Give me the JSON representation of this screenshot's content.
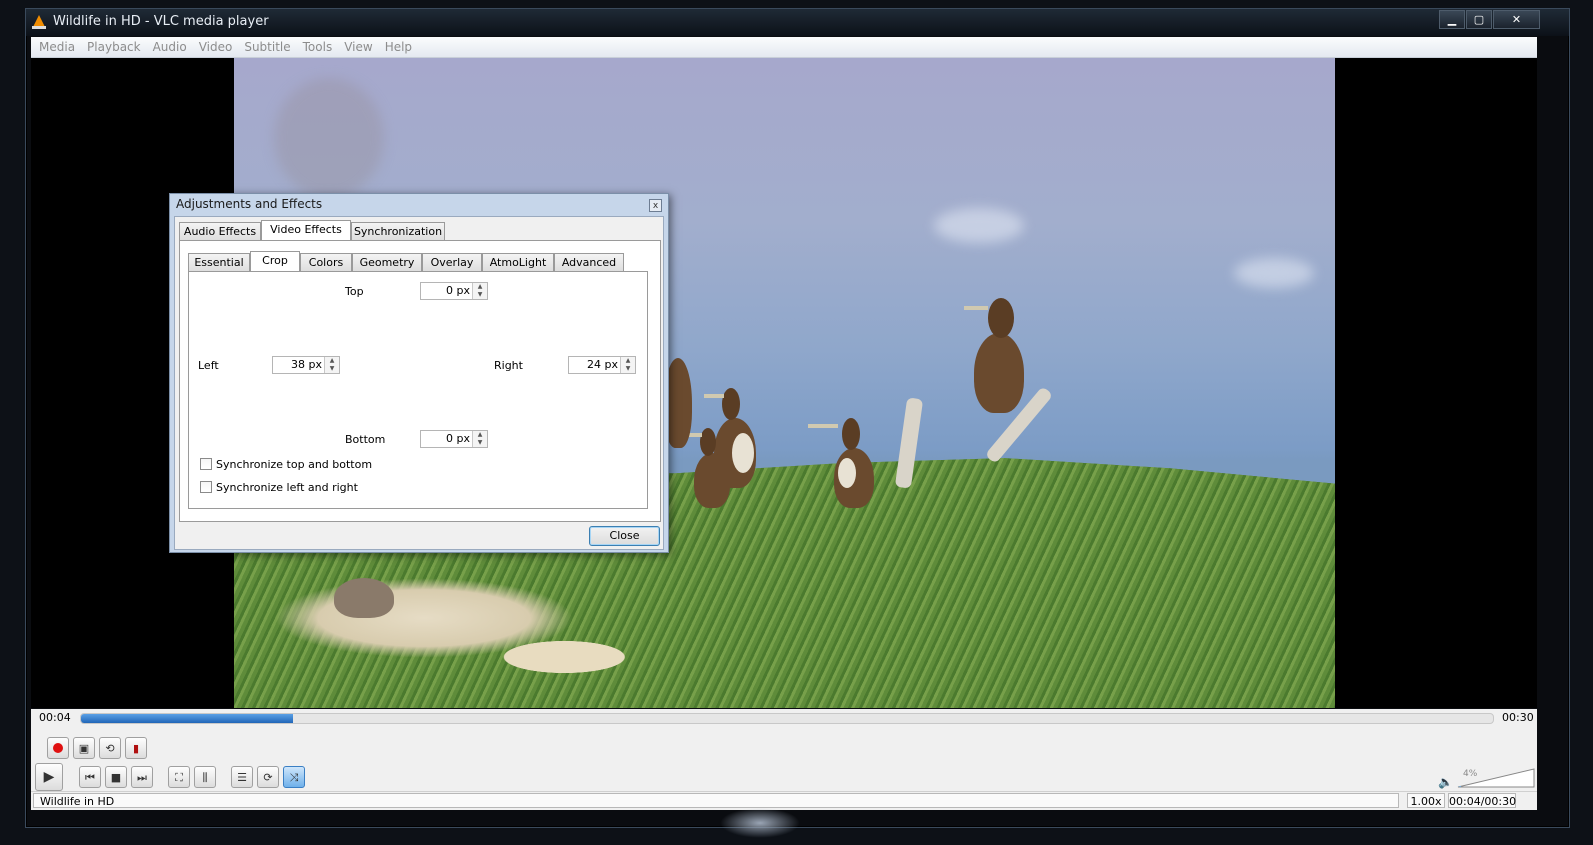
{
  "window": {
    "title": "Wildlife in HD - VLC media player",
    "min_label": "▁",
    "max_label": "▢",
    "close_label": "✕"
  },
  "menu": [
    "Media",
    "Playback",
    "Audio",
    "Video",
    "Subtitle",
    "Tools",
    "View",
    "Help"
  ],
  "player": {
    "time_current": "00:04",
    "time_total": "00:30",
    "progress": 0.15,
    "volume_label": "4%",
    "status_title": "Wildlife in HD",
    "status_rate": "1.00x",
    "status_time": "00:04/00:30",
    "accent_color": "#2166b8"
  },
  "dialog": {
    "title": "Adjustments and Effects",
    "close_x": "x",
    "main_tabs": [
      "Audio Effects",
      "Video Effects",
      "Synchronization"
    ],
    "sub_tabs": [
      "Essential",
      "Crop",
      "Colors",
      "Geometry",
      "Overlay",
      "AtmoLight",
      "Advanced"
    ],
    "crop": {
      "top_label": "Top",
      "top_value": "0 px",
      "left_label": "Left",
      "left_value": "38 px",
      "right_label": "Right",
      "right_value": "24 px",
      "bottom_label": "Bottom",
      "bottom_value": "0 px",
      "sync_tb_label": "Synchronize top and bottom",
      "sync_lr_label": "Synchronize left and right"
    },
    "close_button": "Close"
  },
  "icons": {
    "record": "record-icon",
    "snapshot": "snapshot-icon",
    "loop_ab": "loop-ab-icon",
    "frame_step": "frame-by-frame-icon",
    "play": "play-icon",
    "prev": "previous-icon",
    "stop": "stop-icon",
    "next": "next-icon",
    "fullscreen": "fullscreen-icon",
    "extended": "extended-settings-icon",
    "playlist": "playlist-icon",
    "loop": "loop-icon",
    "shuffle": "shuffle-icon",
    "volume": "speaker-icon"
  }
}
